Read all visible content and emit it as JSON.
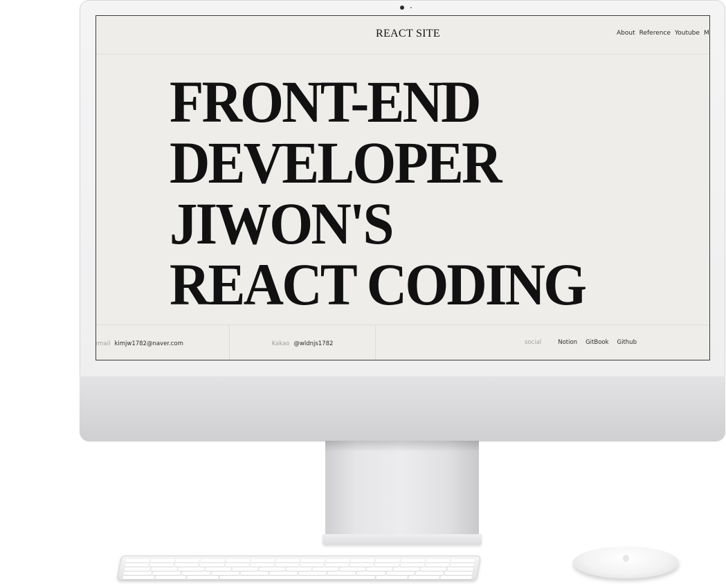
{
  "site": {
    "logo": "REACT SITE",
    "nav": [
      "About",
      "Reference",
      "Youtube",
      "Me"
    ]
  },
  "hero": {
    "lines": [
      "FRONT-END",
      "DEVELOPER",
      "JIWON'S",
      "REACT CODING"
    ]
  },
  "contact": {
    "email_label": "email",
    "email_value": "kimjw1782@naver.com",
    "kakao_label": "Kakao",
    "kakao_value": "@wldnjs1782",
    "social_label": "social",
    "social_links": [
      "Notion",
      "GitBook",
      "Github"
    ]
  }
}
